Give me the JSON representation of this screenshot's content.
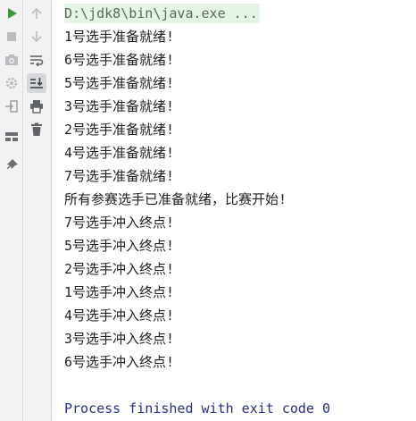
{
  "colors": {
    "run_green": "#3c9a3c",
    "icon_gray": "#8a8d92",
    "command_bg": "#e4f5e6",
    "process_text": "#2a2f8a"
  },
  "toolbar": {
    "left_icons": [
      "run-icon",
      "stop-icon",
      "camera-icon",
      "settings-icon",
      "import-icon",
      "layout-icon",
      "pin-icon"
    ],
    "right_icons": [
      "arrow-up-icon",
      "arrow-down-icon",
      "soft-wrap-icon",
      "scroll-to-end-icon",
      "print-icon",
      "trash-icon"
    ]
  },
  "console": {
    "command": "D:\\jdk8\\bin\\java.exe ...",
    "lines": [
      "1号选手准备就绪!",
      "6号选手准备就绪!",
      "5号选手准备就绪!",
      "3号选手准备就绪!",
      "2号选手准备就绪!",
      "4号选手准备就绪!",
      "7号选手准备就绪!",
      "所有参赛选手已准备就绪，比赛开始!",
      "7号选手冲入终点!",
      "5号选手冲入终点!",
      "2号选手冲入终点!",
      "1号选手冲入终点!",
      "4号选手冲入终点!",
      "3号选手冲入终点!",
      "6号选手冲入终点!"
    ],
    "exit_message": "Process finished with exit code 0"
  }
}
